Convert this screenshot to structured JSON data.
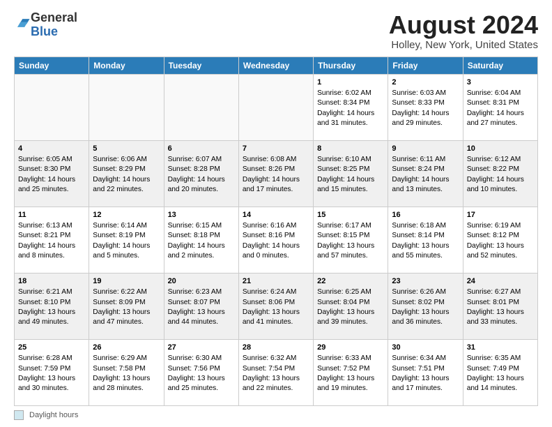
{
  "header": {
    "logo_general": "General",
    "logo_blue": "Blue",
    "month_title": "August 2024",
    "location": "Holley, New York, United States"
  },
  "weekdays": [
    "Sunday",
    "Monday",
    "Tuesday",
    "Wednesday",
    "Thursday",
    "Friday",
    "Saturday"
  ],
  "footer": {
    "legend_label": "Daylight hours"
  },
  "weeks": [
    [
      {
        "day": "",
        "content": ""
      },
      {
        "day": "",
        "content": ""
      },
      {
        "day": "",
        "content": ""
      },
      {
        "day": "",
        "content": ""
      },
      {
        "day": "1",
        "content": "Sunrise: 6:02 AM\nSunset: 8:34 PM\nDaylight: 14 hours\nand 31 minutes."
      },
      {
        "day": "2",
        "content": "Sunrise: 6:03 AM\nSunset: 8:33 PM\nDaylight: 14 hours\nand 29 minutes."
      },
      {
        "day": "3",
        "content": "Sunrise: 6:04 AM\nSunset: 8:31 PM\nDaylight: 14 hours\nand 27 minutes."
      }
    ],
    [
      {
        "day": "4",
        "content": "Sunrise: 6:05 AM\nSunset: 8:30 PM\nDaylight: 14 hours\nand 25 minutes."
      },
      {
        "day": "5",
        "content": "Sunrise: 6:06 AM\nSunset: 8:29 PM\nDaylight: 14 hours\nand 22 minutes."
      },
      {
        "day": "6",
        "content": "Sunrise: 6:07 AM\nSunset: 8:28 PM\nDaylight: 14 hours\nand 20 minutes."
      },
      {
        "day": "7",
        "content": "Sunrise: 6:08 AM\nSunset: 8:26 PM\nDaylight: 14 hours\nand 17 minutes."
      },
      {
        "day": "8",
        "content": "Sunrise: 6:10 AM\nSunset: 8:25 PM\nDaylight: 14 hours\nand 15 minutes."
      },
      {
        "day": "9",
        "content": "Sunrise: 6:11 AM\nSunset: 8:24 PM\nDaylight: 14 hours\nand 13 minutes."
      },
      {
        "day": "10",
        "content": "Sunrise: 6:12 AM\nSunset: 8:22 PM\nDaylight: 14 hours\nand 10 minutes."
      }
    ],
    [
      {
        "day": "11",
        "content": "Sunrise: 6:13 AM\nSunset: 8:21 PM\nDaylight: 14 hours\nand 8 minutes."
      },
      {
        "day": "12",
        "content": "Sunrise: 6:14 AM\nSunset: 8:19 PM\nDaylight: 14 hours\nand 5 minutes."
      },
      {
        "day": "13",
        "content": "Sunrise: 6:15 AM\nSunset: 8:18 PM\nDaylight: 14 hours\nand 2 minutes."
      },
      {
        "day": "14",
        "content": "Sunrise: 6:16 AM\nSunset: 8:16 PM\nDaylight: 14 hours\nand 0 minutes."
      },
      {
        "day": "15",
        "content": "Sunrise: 6:17 AM\nSunset: 8:15 PM\nDaylight: 13 hours\nand 57 minutes."
      },
      {
        "day": "16",
        "content": "Sunrise: 6:18 AM\nSunset: 8:14 PM\nDaylight: 13 hours\nand 55 minutes."
      },
      {
        "day": "17",
        "content": "Sunrise: 6:19 AM\nSunset: 8:12 PM\nDaylight: 13 hours\nand 52 minutes."
      }
    ],
    [
      {
        "day": "18",
        "content": "Sunrise: 6:21 AM\nSunset: 8:10 PM\nDaylight: 13 hours\nand 49 minutes."
      },
      {
        "day": "19",
        "content": "Sunrise: 6:22 AM\nSunset: 8:09 PM\nDaylight: 13 hours\nand 47 minutes."
      },
      {
        "day": "20",
        "content": "Sunrise: 6:23 AM\nSunset: 8:07 PM\nDaylight: 13 hours\nand 44 minutes."
      },
      {
        "day": "21",
        "content": "Sunrise: 6:24 AM\nSunset: 8:06 PM\nDaylight: 13 hours\nand 41 minutes."
      },
      {
        "day": "22",
        "content": "Sunrise: 6:25 AM\nSunset: 8:04 PM\nDaylight: 13 hours\nand 39 minutes."
      },
      {
        "day": "23",
        "content": "Sunrise: 6:26 AM\nSunset: 8:02 PM\nDaylight: 13 hours\nand 36 minutes."
      },
      {
        "day": "24",
        "content": "Sunrise: 6:27 AM\nSunset: 8:01 PM\nDaylight: 13 hours\nand 33 minutes."
      }
    ],
    [
      {
        "day": "25",
        "content": "Sunrise: 6:28 AM\nSunset: 7:59 PM\nDaylight: 13 hours\nand 30 minutes."
      },
      {
        "day": "26",
        "content": "Sunrise: 6:29 AM\nSunset: 7:58 PM\nDaylight: 13 hours\nand 28 minutes."
      },
      {
        "day": "27",
        "content": "Sunrise: 6:30 AM\nSunset: 7:56 PM\nDaylight: 13 hours\nand 25 minutes."
      },
      {
        "day": "28",
        "content": "Sunrise: 6:32 AM\nSunset: 7:54 PM\nDaylight: 13 hours\nand 22 minutes."
      },
      {
        "day": "29",
        "content": "Sunrise: 6:33 AM\nSunset: 7:52 PM\nDaylight: 13 hours\nand 19 minutes."
      },
      {
        "day": "30",
        "content": "Sunrise: 6:34 AM\nSunset: 7:51 PM\nDaylight: 13 hours\nand 17 minutes."
      },
      {
        "day": "31",
        "content": "Sunrise: 6:35 AM\nSunset: 7:49 PM\nDaylight: 13 hours\nand 14 minutes."
      }
    ]
  ]
}
